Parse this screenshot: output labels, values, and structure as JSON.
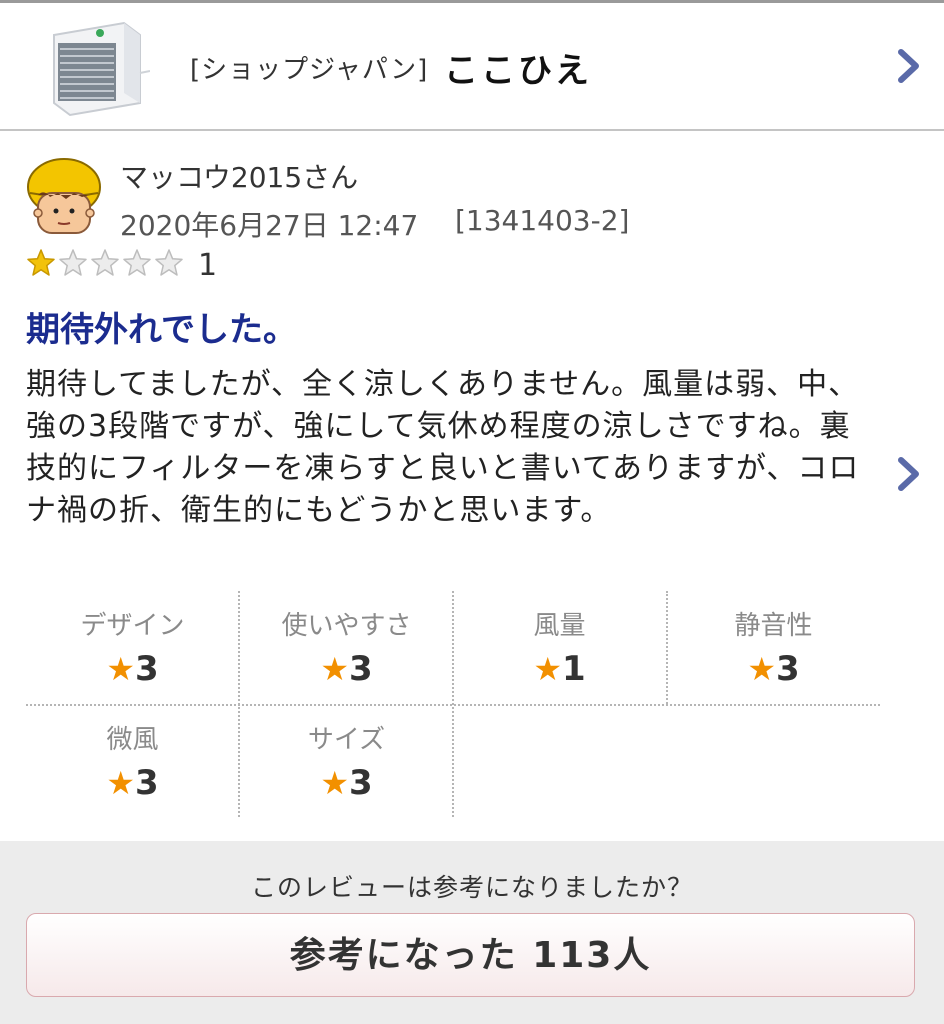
{
  "product": {
    "shop": "[ショップジャパン]",
    "name": "ここひえ"
  },
  "review": {
    "reviewer": "マッコウ2015さん",
    "date": "2020年6月27日 12:47",
    "id": "[1341403-2]",
    "rating": 1,
    "rating_max": 5,
    "rating_label": "1",
    "title": "期待外れでした。",
    "body": "期待してましたが、全く涼しくありません。風量は弱、中、強の3段階ですが、強にして気休め程度の涼しさですね。裏技的にフィルターを凍らすと良いと書いてありますが、コロナ禍の折、衛生的にもどうかと思います。"
  },
  "sub_ratings": [
    {
      "label": "デザイン",
      "score": "3"
    },
    {
      "label": "使いやすさ",
      "score": "3"
    },
    {
      "label": "風量",
      "score": "1"
    },
    {
      "label": "静音性",
      "score": "3"
    },
    {
      "label": "微風",
      "score": "3"
    },
    {
      "label": "サイズ",
      "score": "3"
    }
  ],
  "helpful": {
    "question": "このレビューは参考になりましたか？",
    "button": "参考になった 113人"
  },
  "colors": {
    "title": "#1b2c8f",
    "star": "#f29000",
    "chevron": "#5a6aa8"
  },
  "icons": {
    "chevron": "chevron-right-icon",
    "star_filled": "star-filled-icon",
    "star_empty": "star-empty-icon",
    "avatar": "avatar-icon",
    "product": "product-image"
  }
}
